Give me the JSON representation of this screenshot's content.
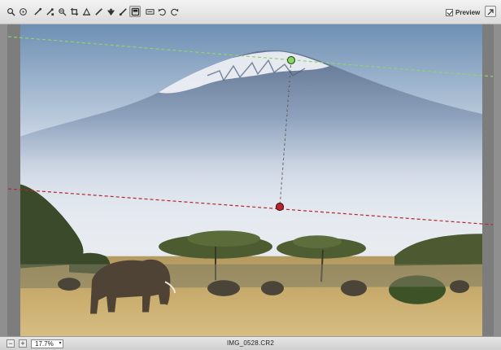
{
  "toolbar": {
    "tools": [
      {
        "icon": "zoom-icon",
        "selected": false
      },
      {
        "icon": "hand-icon",
        "selected": false
      },
      {
        "icon": "white-balance-icon",
        "selected": false
      },
      {
        "icon": "color-sampler-icon",
        "selected": false
      },
      {
        "icon": "targeted-adjustment-icon",
        "selected": false
      },
      {
        "icon": "crop-icon",
        "selected": false
      },
      {
        "icon": "straighten-icon",
        "selected": false
      },
      {
        "icon": "spot-removal-icon",
        "selected": false
      },
      {
        "icon": "red-eye-icon",
        "selected": false
      },
      {
        "icon": "adjustment-brush-icon",
        "selected": false
      },
      {
        "icon": "graduated-filter-icon",
        "selected": true
      },
      {
        "icon": "preferences-icon",
        "selected": false
      },
      {
        "icon": "rotate-left-icon",
        "selected": false
      },
      {
        "icon": "rotate-right-icon",
        "selected": false
      }
    ],
    "preview_label": "Preview",
    "preview_checked": true
  },
  "status": {
    "zoom_value": "17.7%",
    "filename": "IMG_0528.CR2"
  },
  "colors": {
    "sky_top": "#6e8fb3",
    "haze": "#dfe5ee",
    "savanna": "#c9ad6e",
    "grad_start": "#8fd36b",
    "grad_end": "#b3262f"
  }
}
